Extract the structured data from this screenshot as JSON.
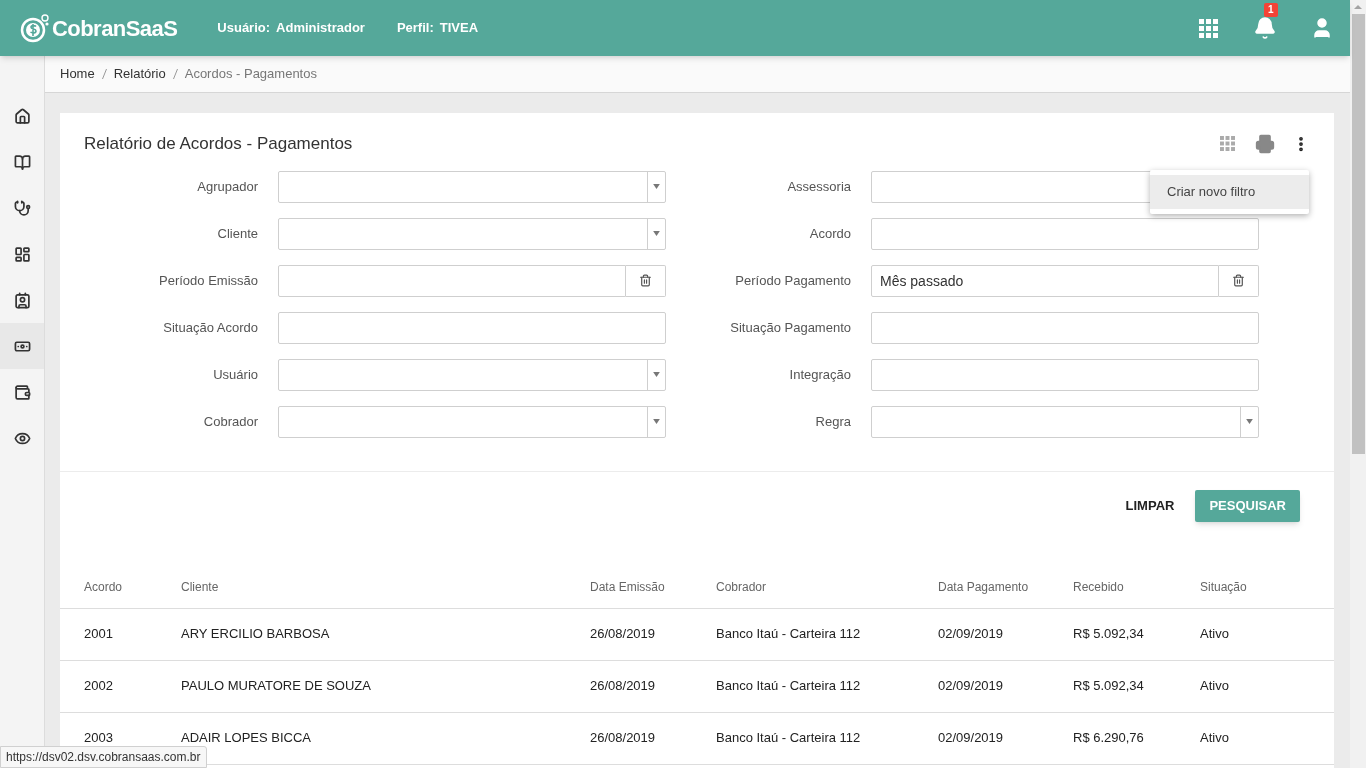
{
  "header": {
    "logo": "CobranSaaS",
    "user_label": "Usuário:",
    "user_value": "Administrador",
    "profile_label": "Perfil:",
    "profile_value": "TIVEA",
    "notification_count": "1"
  },
  "sidebar": {
    "items": [
      {
        "kind": "home",
        "selected": false
      },
      {
        "kind": "book",
        "selected": false
      },
      {
        "kind": "stethoscope",
        "selected": false
      },
      {
        "kind": "widgets",
        "selected": false
      },
      {
        "kind": "contact",
        "selected": false
      },
      {
        "kind": "money",
        "selected": true
      },
      {
        "kind": "wallet",
        "selected": false
      },
      {
        "kind": "eye",
        "selected": false
      }
    ]
  },
  "breadcrumb": [
    {
      "label": "Home",
      "current": false
    },
    {
      "label": "Relatório",
      "current": false
    },
    {
      "label": "Acordos - Pagamentos",
      "current": true
    }
  ],
  "card": {
    "title": "Relatório de Acordos - Pagamentos",
    "menu": {
      "items": [
        "Criar novo filtro"
      ]
    },
    "filters": [
      {
        "label": "Agrupador",
        "kind": "select"
      },
      {
        "label": "Assessoria",
        "kind": "select"
      },
      {
        "label": "Cliente",
        "kind": "select"
      },
      {
        "label": "Acordo",
        "kind": "text"
      },
      {
        "label": "Período Emissão",
        "kind": "date"
      },
      {
        "label": "Período Pagamento",
        "kind": "date",
        "value": "Mês passado"
      },
      {
        "label": "Situação Acordo",
        "kind": "text"
      },
      {
        "label": "Situação Pagamento",
        "kind": "text"
      },
      {
        "label": "Usuário",
        "kind": "select"
      },
      {
        "label": "Integração",
        "kind": "text"
      },
      {
        "label": "Cobrador",
        "kind": "select"
      },
      {
        "label": "Regra",
        "kind": "select"
      }
    ],
    "buttons": [
      {
        "label": "LIMPAR",
        "kind": "flat"
      },
      {
        "label": "PESQUISAR",
        "kind": "raised"
      }
    ]
  },
  "table": {
    "columns": [
      "Acordo",
      "Cliente",
      "Data Emissão",
      "Cobrador",
      "Data Pagamento",
      "Recebido",
      "Situação"
    ],
    "rows": [
      [
        "2001",
        "ARY ERCILIO BARBOSA",
        "26/08/2019",
        "Banco Itaú - Carteira 112",
        "02/09/2019",
        "R$ 5.092,34",
        "Ativo"
      ],
      [
        "2002",
        "PAULO MURATORE DE SOUZA",
        "26/08/2019",
        "Banco Itaú - Carteira 112",
        "02/09/2019",
        "R$ 5.092,34",
        "Ativo"
      ],
      [
        "2003",
        "ADAIR LOPES BICCA",
        "26/08/2019",
        "Banco Itaú - Carteira 112",
        "02/09/2019",
        "R$ 6.290,76",
        "Ativo"
      ]
    ]
  },
  "status_url": "https://dsv02.dsv.cobransaas.com.br"
}
